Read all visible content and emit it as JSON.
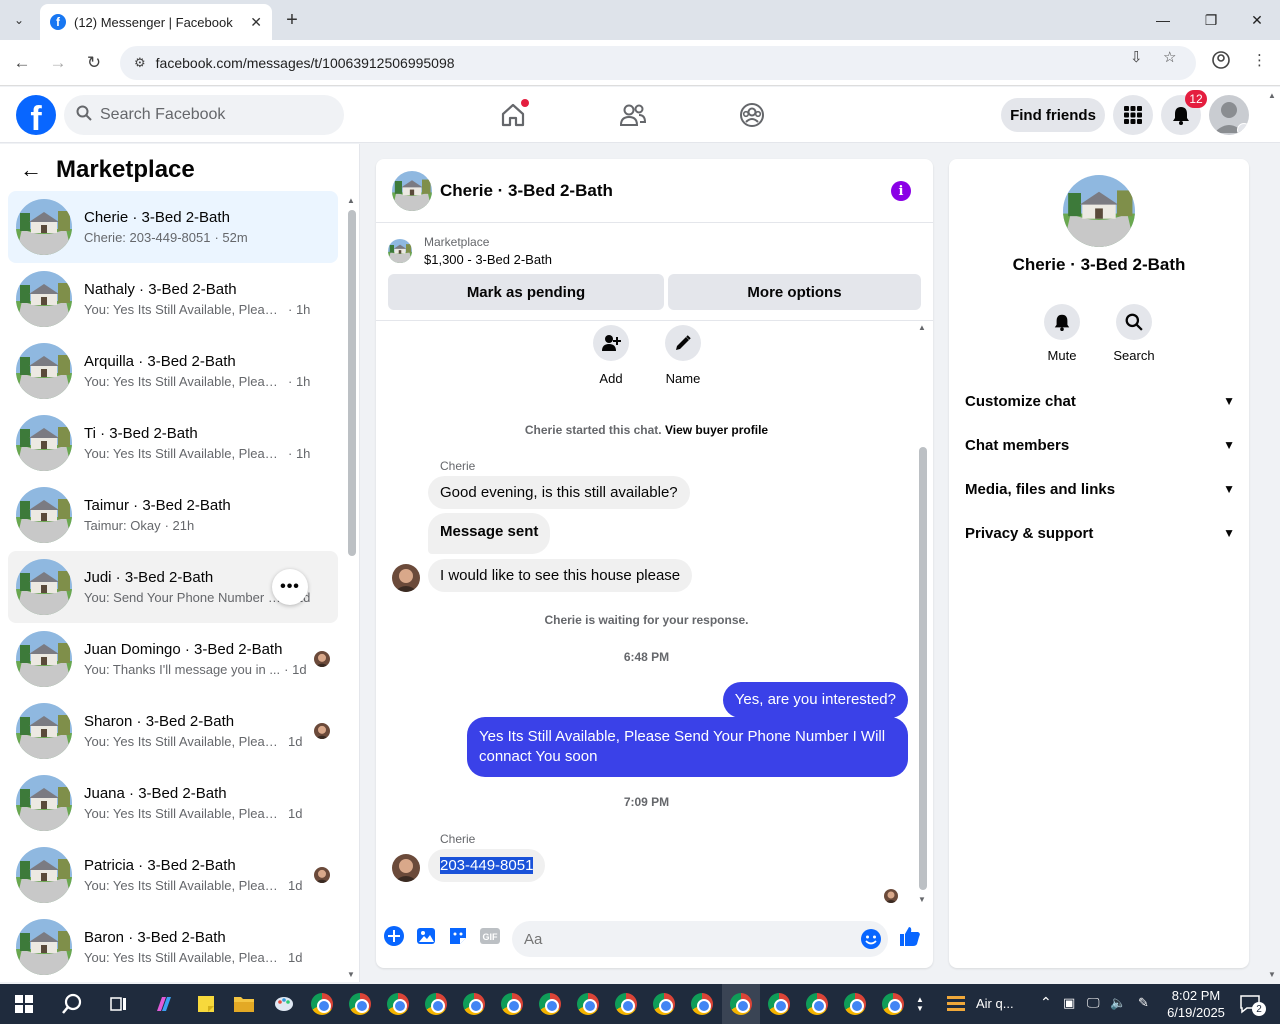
{
  "browser": {
    "tab_title": "(12) Messenger | Facebook",
    "url": "facebook.com/messages/t/10063912506995098"
  },
  "header": {
    "search_placeholder": "Search Facebook",
    "find_friends": "Find friends",
    "notif_count": "12"
  },
  "sidebar": {
    "title": "Marketplace",
    "conversations": [
      {
        "name": "Cherie · 3-Bed 2-Bath",
        "snippet": "Cherie: 203-449-8051",
        "time": "· 52m"
      },
      {
        "name": "Nathaly · 3-Bed 2-Bath",
        "snippet": "You: Yes Its Still Available, Please Se...",
        "time": "· 1h"
      },
      {
        "name": "Arquilla · 3-Bed 2-Bath",
        "snippet": "You: Yes Its Still Available, Please Se...",
        "time": "· 1h"
      },
      {
        "name": "Ti · 3-Bed 2-Bath",
        "snippet": "You: Yes Its Still Available, Please Se...",
        "time": "· 1h"
      },
      {
        "name": "Taimur · 3-Bed 2-Bath",
        "snippet": "Taimur: Okay",
        "time": "· 21h"
      },
      {
        "name": "Judi · 3-Bed 2-Bath",
        "snippet": "You: Send Your Phone Number I Will",
        "time": "· 1d"
      },
      {
        "name": "Juan Domingo · 3-Bed 2-Bath",
        "snippet": "You: Thanks I'll message you in ...",
        "time": "· 1d"
      },
      {
        "name": "Sharon · 3-Bed 2-Bath",
        "snippet": "You: Yes Its Still Available, Please...",
        "time": "1d"
      },
      {
        "name": "Juana · 3-Bed 2-Bath",
        "snippet": "You: Yes Its Still Available, Please Se...",
        "time": "1d"
      },
      {
        "name": "Patricia · 3-Bed 2-Bath",
        "snippet": "You: Yes Its Still Available, Please...",
        "time": "1d"
      },
      {
        "name": "Baron · 3-Bed 2-Bath",
        "snippet": "You: Yes Its Still Available, Please Se...",
        "time": "1d"
      }
    ]
  },
  "chat": {
    "title": "Cherie · 3-Bed 2-Bath",
    "marketplace_label": "Marketplace",
    "listing": "$1,300 - 3-Bed 2-Bath",
    "mark_pending": "Mark as pending",
    "more_options": "More options",
    "add_label": "Add",
    "name_label": "Name",
    "started": "Cherie started this chat.",
    "view_profile": "View buyer profile",
    "sender1": "Cherie",
    "msg1": "Good evening, is this still available?",
    "msg2": "Message sent",
    "msg3": "I would like to see this house please",
    "waiting": "Cherie is waiting for your response.",
    "time1": "6:48 PM",
    "out1": "Yes, are you interested?",
    "out2": "Yes Its Still Available, Please Send Your Phone Number I Will connact You soon",
    "time2": "7:09 PM",
    "sender2": "Cherie",
    "msg4": "203-449-8051",
    "composer_placeholder": "Aa"
  },
  "details": {
    "name": "Cherie · 3-Bed 2-Bath",
    "mute": "Mute",
    "search": "Search",
    "sections": [
      "Customize chat",
      "Chat members",
      "Media, files and links",
      "Privacy & support"
    ]
  },
  "taskbar": {
    "weather": "Air q...",
    "time": "8:02 PM",
    "date": "6/19/2025",
    "notif": "2"
  },
  "colors": {
    "fb_blue": "#0866ff",
    "outgoing_bubble": "#3a41e8",
    "info_purple": "#8a00e6",
    "badge_red": "#e41e3f"
  }
}
